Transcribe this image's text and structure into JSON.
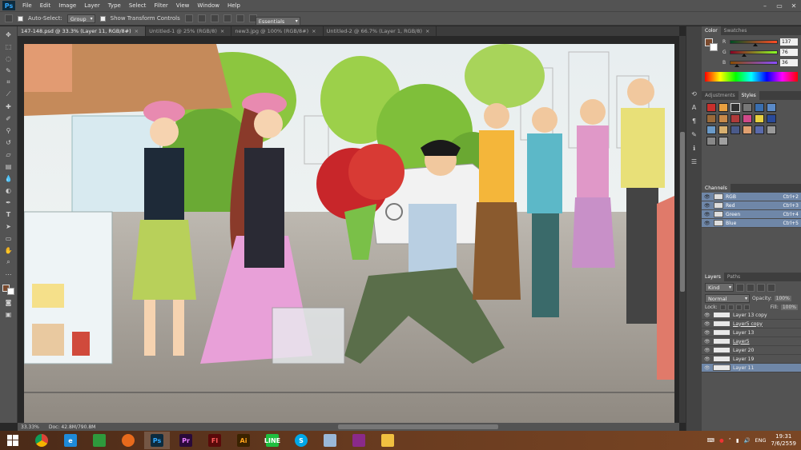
{
  "app": {
    "logo": "Ps"
  },
  "menu": [
    "File",
    "Edit",
    "Image",
    "Layer",
    "Type",
    "Select",
    "Filter",
    "View",
    "Window",
    "Help"
  ],
  "window_controls": [
    "–",
    "▭",
    "✕"
  ],
  "options": {
    "auto_select_label": "Auto-Select:",
    "auto_select_value": "Group",
    "transform_label": "Show Transform Controls",
    "workspace": "Essentials"
  },
  "tabs": [
    {
      "label": "147-148.psd @ 33.3% (Layer 11, RGB/8#)",
      "active": true
    },
    {
      "label": "Untitled-1 @ 25% (RGB/8)",
      "active": false
    },
    {
      "label": "new3.jpg @ 100% (RGB/8#)",
      "active": false
    },
    {
      "label": "Untitled-2 @ 66.7% (Layer 1, RGB/8)",
      "active": false
    }
  ],
  "tab_close": "×",
  "status": {
    "zoom": "33.33%",
    "doc": "Doc: 42.8M/790.8M"
  },
  "color_panel": {
    "tabs": [
      "Color",
      "Swatches"
    ],
    "fg": "#7a4a2e",
    "sliders": [
      {
        "label": "R",
        "value": "137",
        "pos": 0.54
      },
      {
        "label": "G",
        "value": "76",
        "pos": 0.3
      },
      {
        "label": "B",
        "value": "36",
        "pos": 0.14
      }
    ]
  },
  "styles_panel": {
    "tabs": [
      "Adjustments",
      "Styles"
    ]
  },
  "channels_panel": {
    "title": "Channels",
    "rows": [
      {
        "name": "RGB",
        "shortcut": "Ctrl+2"
      },
      {
        "name": "Red",
        "shortcut": "Ctrl+3"
      },
      {
        "name": "Green",
        "shortcut": "Ctrl+4"
      },
      {
        "name": "Blue",
        "shortcut": "Ctrl+5"
      }
    ]
  },
  "layers_panel": {
    "tabs": [
      "Layers",
      "Paths"
    ],
    "filter": "Kind",
    "blend_mode": "Normal",
    "opacity_label": "Opacity:",
    "opacity_value": "100%",
    "lock_label": "Lock:",
    "fill_label": "Fill:",
    "fill_value": "100%",
    "rows": [
      {
        "name": "Layer 13 copy",
        "selected": false,
        "underline": false
      },
      {
        "name": "Layer5 copy",
        "selected": false,
        "underline": true
      },
      {
        "name": "Layer 13",
        "selected": false,
        "underline": false
      },
      {
        "name": "Layer5",
        "selected": false,
        "underline": true
      },
      {
        "name": "Layer 20",
        "selected": false,
        "underline": false
      },
      {
        "name": "Layer 19",
        "selected": false,
        "underline": false
      },
      {
        "name": "Layer 11",
        "selected": true,
        "underline": false
      }
    ]
  },
  "taskbar": {
    "apps": [
      {
        "icon": "windows-icon",
        "label": "",
        "bg": "transparent",
        "fg": "#fff"
      },
      {
        "icon": "chrome-icon",
        "label": "",
        "bg": "#e8e8e8",
        "fg": "#333"
      },
      {
        "icon": "ie-icon",
        "label": "e",
        "bg": "#1e8ad8",
        "fg": "#fff"
      },
      {
        "icon": "store-icon",
        "label": "",
        "bg": "#2e9a3c",
        "fg": "#fff"
      },
      {
        "icon": "firefox-icon",
        "label": "",
        "bg": "#e86a1c",
        "fg": "#fff"
      },
      {
        "icon": "photoshop-icon",
        "label": "Ps",
        "bg": "#0d2b3e",
        "fg": "#31a8ff",
        "active": true
      },
      {
        "icon": "premiere-icon",
        "label": "Pr",
        "bg": "#2a0a3a",
        "fg": "#e77bff"
      },
      {
        "icon": "flash-icon",
        "label": "Fl",
        "bg": "#5a0a0a",
        "fg": "#ff5a5a"
      },
      {
        "icon": "illustrator-icon",
        "label": "Ai",
        "bg": "#3a2200",
        "fg": "#ffa31a"
      },
      {
        "icon": "line-icon",
        "label": "LINE",
        "bg": "#1fbf3f",
        "fg": "#fff"
      },
      {
        "icon": "skype-icon",
        "label": "S",
        "bg": "#00a8e8",
        "fg": "#fff"
      },
      {
        "icon": "app-icon",
        "label": "",
        "bg": "#9ab8d8",
        "fg": "#fff"
      },
      {
        "icon": "winrar-icon",
        "label": "",
        "bg": "#8a2a8a",
        "fg": "#fff"
      },
      {
        "icon": "explorer-icon",
        "label": "",
        "bg": "#f0c040",
        "fg": "#333"
      }
    ],
    "language": "ENG",
    "time": "19:31",
    "date": "7/6/2559"
  }
}
